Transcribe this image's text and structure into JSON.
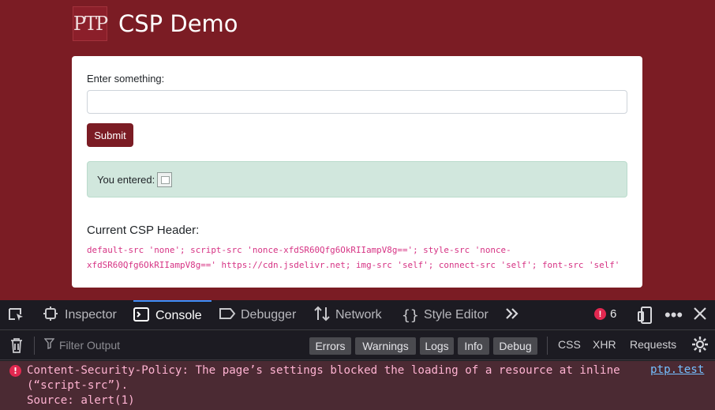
{
  "header": {
    "logo_text": "PTP",
    "title": "CSP Demo"
  },
  "form": {
    "label": "Enter something:",
    "input_value": "",
    "submit_label": "Submit"
  },
  "result": {
    "label": "You entered:"
  },
  "csp": {
    "heading": "Current CSP Header:",
    "line1": "default-src 'none'; script-src 'nonce-xfdSR60Qfg6OkRIIampV8g=='; style-src 'nonce-",
    "line2": "xfdSR60Qfg6OkRIIampV8g==' https://cdn.jsdelivr.net; img-src 'self'; connect-src 'self'; font-src 'self'"
  },
  "devtools": {
    "tabs": [
      {
        "label": "Inspector",
        "icon": "inspector-icon"
      },
      {
        "label": "Console",
        "icon": "console-icon"
      },
      {
        "label": "Debugger",
        "icon": "debugger-icon"
      },
      {
        "label": "Network",
        "icon": "network-icon"
      },
      {
        "label": "Style Editor",
        "icon": "style-editor-icon"
      }
    ],
    "active_tab": "Console",
    "error_count": "6",
    "filter_placeholder": "Filter Output",
    "levels": [
      "Errors",
      "Warnings",
      "Logs",
      "Info",
      "Debug"
    ],
    "types": [
      "CSS",
      "XHR",
      "Requests"
    ],
    "message": {
      "text": "Content-Security-Policy: The page’s settings blocked the loading of a resource at inline\n(“script-src”).\nSource: alert(1)",
      "source_link": "ptp.test"
    }
  },
  "colors": {
    "page_bg": "#7b1c24",
    "button_bg": "#7b1c24",
    "alert_bg": "#d1e7dd",
    "code_color": "#d63384",
    "devtools_bg": "#1c1b22",
    "error_bg": "#4b2a33",
    "error_text": "#ffb3d2",
    "active_tab_accent": "#3e8ef7"
  }
}
